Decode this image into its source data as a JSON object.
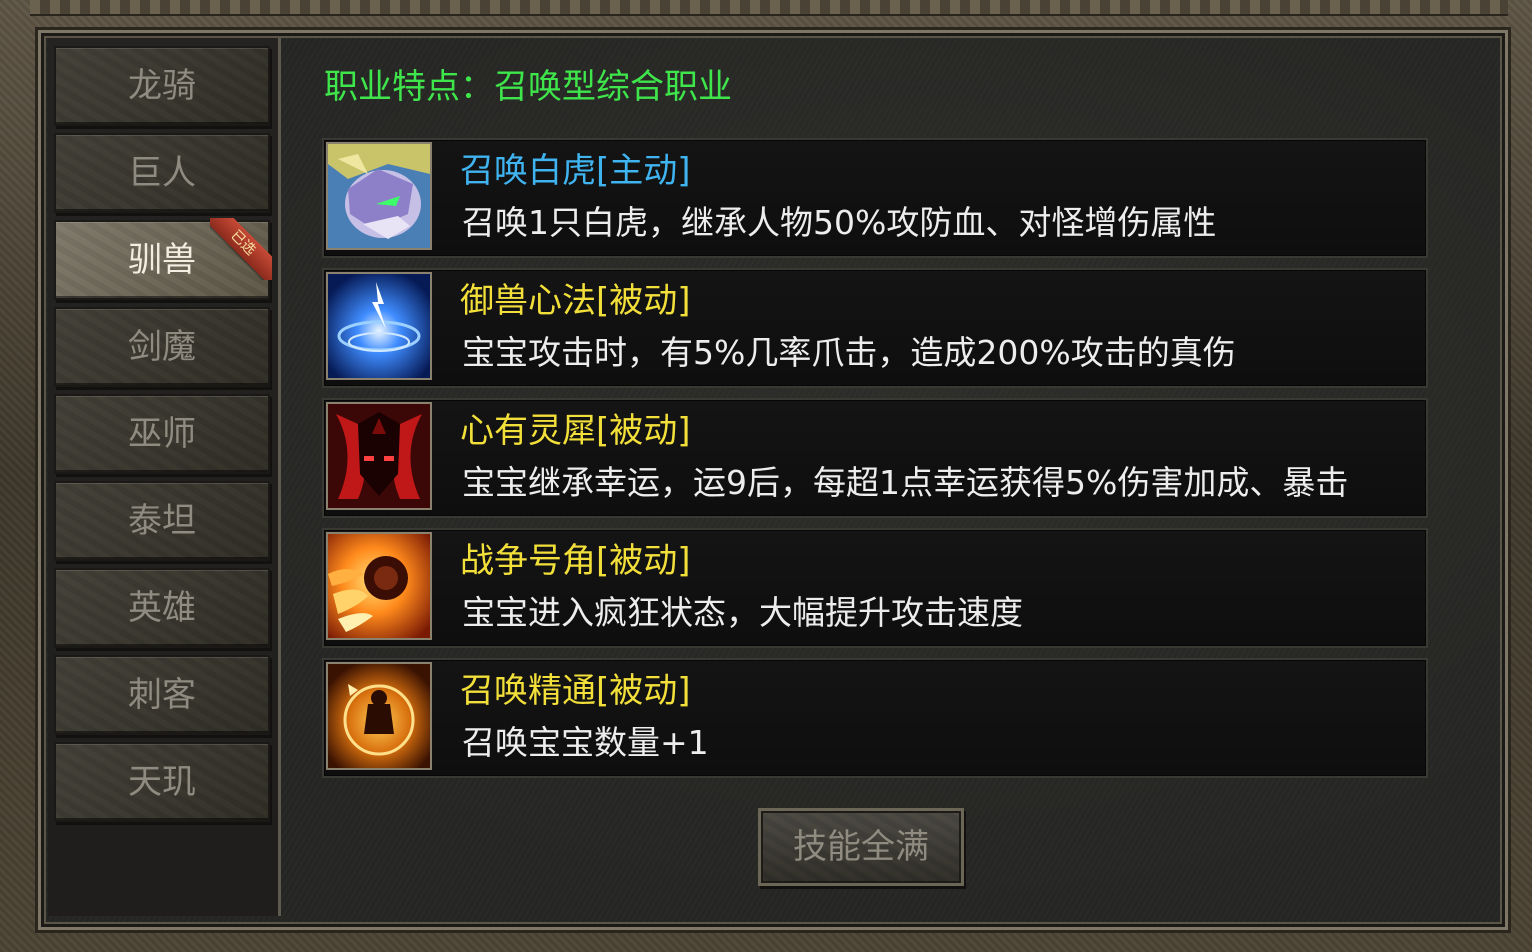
{
  "sidebar": {
    "tabs": [
      {
        "label": "龙骑"
      },
      {
        "label": "巨人"
      },
      {
        "label": "驯兽",
        "active": true,
        "badge": "已选"
      },
      {
        "label": "剑魔"
      },
      {
        "label": "巫师"
      },
      {
        "label": "泰坦"
      },
      {
        "label": "英雄"
      },
      {
        "label": "刺客"
      },
      {
        "label": "天玑"
      }
    ]
  },
  "main": {
    "class_feature": "职业特点：召唤型综合职业",
    "skills": [
      {
        "name": "召唤白虎[主动]",
        "desc": "召唤1只白虎，继承人物50%攻防血、对怪增伤属性",
        "name_color": "#3fb4f0",
        "icon": "white-tiger-icon"
      },
      {
        "name": "御兽心法[被动]",
        "desc": "宝宝攻击时，有5%几率爪击，造成200%攻击的真伤",
        "name_color": "#f2df3a",
        "icon": "blue-vortex-icon"
      },
      {
        "name": "心有灵犀[被动]",
        "desc": "宝宝继承幸运，运9后，每超1点幸运获得5%伤害加成、暴击",
        "name_color": "#f2df3a",
        "icon": "red-demon-icon"
      },
      {
        "name": "战争号角[被动]",
        "desc": "宝宝进入疯狂状态，大幅提升攻击速度",
        "name_color": "#f2df3a",
        "icon": "war-horn-icon"
      },
      {
        "name": "召唤精通[被动]",
        "desc": "召唤宝宝数量+1",
        "name_color": "#f2df3a",
        "icon": "summon-mastery-icon"
      }
    ],
    "max_skills_button": "技能全满"
  }
}
